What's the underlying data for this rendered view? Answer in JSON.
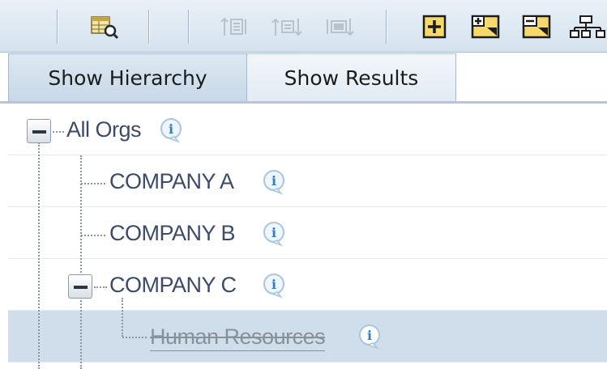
{
  "toolbar": {
    "icons": [
      "search-table-icon",
      "move-up-icon",
      "move-level-icon",
      "move-down-icon",
      "add-node-icon",
      "add-child-icon",
      "remove-node-icon",
      "hierarchy-icon"
    ]
  },
  "tabs": [
    {
      "label": "Show Hierarchy",
      "active": true
    },
    {
      "label": "Show Results",
      "active": false
    }
  ],
  "tree": {
    "root": {
      "label": "All Orgs",
      "expanded": true
    },
    "items": [
      {
        "label": "COMPANY A"
      },
      {
        "label": "COMPANY B"
      },
      {
        "label": "COMPANY C",
        "expanded": true
      },
      {
        "label": "Human Resources",
        "selected": true
      }
    ],
    "info_glyph": "i"
  },
  "colors": {
    "label": "#3d4a6a",
    "selected_row": "#cfdeea",
    "toolbar": "#dde8f2",
    "info_icon": "#2f7fc4"
  }
}
